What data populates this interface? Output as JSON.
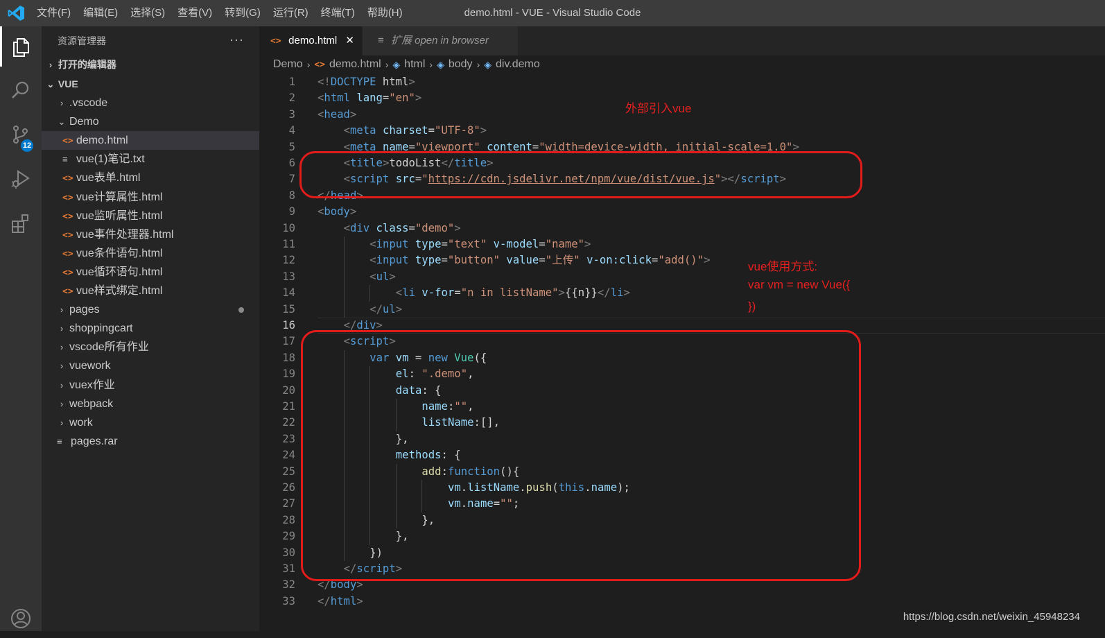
{
  "window": {
    "title": "demo.html - VUE - Visual Studio Code",
    "menu": [
      "文件(F)",
      "编辑(E)",
      "选择(S)",
      "查看(V)",
      "转到(G)",
      "运行(R)",
      "终端(T)",
      "帮助(H)"
    ]
  },
  "activity_bar": {
    "icons": [
      "explorer-icon",
      "search-icon",
      "source-control-icon",
      "run-debug-icon",
      "extensions-icon",
      "account-icon"
    ],
    "scm_badge": "12"
  },
  "sidebar": {
    "title": "资源管理器",
    "more_label": "···",
    "open_editors_label": "打开的编辑器",
    "workspace_label": "VUE",
    "tree": [
      {
        "label": ".vscode",
        "kind": "folder",
        "expanded": false,
        "depth": 1
      },
      {
        "label": "Demo",
        "kind": "folder",
        "expanded": true,
        "depth": 1
      },
      {
        "label": "demo.html",
        "kind": "html",
        "depth": 2,
        "selected": true
      },
      {
        "label": "vue(1)笔记.txt",
        "kind": "txt",
        "depth": 2
      },
      {
        "label": "vue表单.html",
        "kind": "html",
        "depth": 2
      },
      {
        "label": "vue计算属性.html",
        "kind": "html",
        "depth": 2
      },
      {
        "label": "vue监听属性.html",
        "kind": "html",
        "depth": 2
      },
      {
        "label": "vue事件处理器.html",
        "kind": "html",
        "depth": 2
      },
      {
        "label": "vue条件语句.html",
        "kind": "html",
        "depth": 2
      },
      {
        "label": "vue循环语句.html",
        "kind": "html",
        "depth": 2
      },
      {
        "label": "vue样式绑定.html",
        "kind": "html",
        "depth": 2
      },
      {
        "label": "pages",
        "kind": "folder",
        "expanded": false,
        "depth": 1,
        "modified": true
      },
      {
        "label": "shoppingcart",
        "kind": "folder",
        "expanded": false,
        "depth": 1
      },
      {
        "label": "vscode所有作业",
        "kind": "folder",
        "expanded": false,
        "depth": 1
      },
      {
        "label": "vuework",
        "kind": "folder",
        "expanded": false,
        "depth": 1
      },
      {
        "label": "vuex作业",
        "kind": "folder",
        "expanded": false,
        "depth": 1
      },
      {
        "label": "webpack",
        "kind": "folder",
        "expanded": false,
        "depth": 1
      },
      {
        "label": "work",
        "kind": "folder",
        "expanded": false,
        "depth": 1
      },
      {
        "label": "pages.rar",
        "kind": "txt",
        "depth": 1
      }
    ]
  },
  "tabs": [
    {
      "label": "demo.html",
      "active": true,
      "close": "✕"
    },
    {
      "label": "扩展 open in browser",
      "active": false
    }
  ],
  "breadcrumb": [
    "Demo",
    "demo.html",
    "html",
    "body",
    "div.demo"
  ],
  "editor": {
    "current_line": 16,
    "lines": [
      {
        "n": 1,
        "indent": 0,
        "tokens": [
          [
            "punc",
            "<!"
          ],
          [
            "tag",
            "DOCTYPE "
          ],
          [
            "txt",
            "html"
          ],
          [
            "punc",
            ">"
          ]
        ]
      },
      {
        "n": 2,
        "indent": 0,
        "tokens": [
          [
            "punc",
            "<"
          ],
          [
            "tag",
            "html "
          ],
          [
            "attr",
            "lang"
          ],
          [
            "txt",
            "="
          ],
          [
            "str",
            "\"en\""
          ],
          [
            "punc",
            ">"
          ]
        ]
      },
      {
        "n": 3,
        "indent": 0,
        "tokens": [
          [
            "punc",
            "<"
          ],
          [
            "tag",
            "head"
          ],
          [
            "punc",
            ">"
          ]
        ]
      },
      {
        "n": 4,
        "indent": 1,
        "tokens": [
          [
            "punc",
            "<"
          ],
          [
            "tag",
            "meta "
          ],
          [
            "attr",
            "charset"
          ],
          [
            "txt",
            "="
          ],
          [
            "str",
            "\"UTF-8\""
          ],
          [
            "punc",
            ">"
          ]
        ]
      },
      {
        "n": 5,
        "indent": 1,
        "tokens": [
          [
            "punc",
            "<"
          ],
          [
            "tag",
            "meta "
          ],
          [
            "attr",
            "name"
          ],
          [
            "txt",
            "="
          ],
          [
            "str",
            "\"viewport\" "
          ],
          [
            "attr",
            "content"
          ],
          [
            "txt",
            "="
          ],
          [
            "str",
            "\"width=device-width, initial-scale=1.0\""
          ],
          [
            "punc",
            ">"
          ]
        ]
      },
      {
        "n": 6,
        "indent": 1,
        "tokens": [
          [
            "punc",
            "<"
          ],
          [
            "tag",
            "title"
          ],
          [
            "punc",
            ">"
          ],
          [
            "txt",
            "todoList"
          ],
          [
            "punc",
            "</"
          ],
          [
            "tag",
            "title"
          ],
          [
            "punc",
            ">"
          ]
        ]
      },
      {
        "n": 7,
        "indent": 1,
        "tokens": [
          [
            "punc",
            "<"
          ],
          [
            "tag",
            "script "
          ],
          [
            "attr",
            "src"
          ],
          [
            "txt",
            "="
          ],
          [
            "str",
            "\""
          ],
          [
            "link",
            "https://cdn.jsdelivr.net/npm/vue/dist/vue.js"
          ],
          [
            "str",
            "\""
          ],
          [
            "punc",
            "></"
          ],
          [
            "tag",
            "script"
          ],
          [
            "punc",
            ">"
          ]
        ]
      },
      {
        "n": 8,
        "indent": 0,
        "tokens": [
          [
            "punc",
            "</"
          ],
          [
            "tag",
            "head"
          ],
          [
            "punc",
            ">"
          ]
        ]
      },
      {
        "n": 9,
        "indent": 0,
        "tokens": [
          [
            "punc",
            "<"
          ],
          [
            "tag",
            "body"
          ],
          [
            "punc",
            ">"
          ]
        ]
      },
      {
        "n": 10,
        "indent": 1,
        "tokens": [
          [
            "punc",
            "<"
          ],
          [
            "tag",
            "div "
          ],
          [
            "attr",
            "class"
          ],
          [
            "txt",
            "="
          ],
          [
            "str",
            "\"demo\""
          ],
          [
            "punc",
            ">"
          ]
        ]
      },
      {
        "n": 11,
        "indent": 2,
        "tokens": [
          [
            "punc",
            "<"
          ],
          [
            "tag",
            "input "
          ],
          [
            "attr",
            "type"
          ],
          [
            "txt",
            "="
          ],
          [
            "str",
            "\"text\" "
          ],
          [
            "attr",
            "v-model"
          ],
          [
            "txt",
            "="
          ],
          [
            "str",
            "\"name\""
          ],
          [
            "punc",
            ">"
          ]
        ]
      },
      {
        "n": 12,
        "indent": 2,
        "tokens": [
          [
            "punc",
            "<"
          ],
          [
            "tag",
            "input "
          ],
          [
            "attr",
            "type"
          ],
          [
            "txt",
            "="
          ],
          [
            "str",
            "\"button\" "
          ],
          [
            "attr",
            "value"
          ],
          [
            "txt",
            "="
          ],
          [
            "str",
            "\"上传\" "
          ],
          [
            "attr",
            "v-on:click"
          ],
          [
            "txt",
            "="
          ],
          [
            "str",
            "\"add()\""
          ],
          [
            "punc",
            ">"
          ]
        ]
      },
      {
        "n": 13,
        "indent": 2,
        "tokens": [
          [
            "punc",
            "<"
          ],
          [
            "tag",
            "ul"
          ],
          [
            "punc",
            ">"
          ]
        ]
      },
      {
        "n": 14,
        "indent": 3,
        "tokens": [
          [
            "punc",
            "<"
          ],
          [
            "tag",
            "li "
          ],
          [
            "attr",
            "v-for"
          ],
          [
            "txt",
            "="
          ],
          [
            "str",
            "\"n in listName\""
          ],
          [
            "punc",
            ">"
          ],
          [
            "txt",
            "{{n}}"
          ],
          [
            "punc",
            "</"
          ],
          [
            "tag",
            "li"
          ],
          [
            "punc",
            ">"
          ]
        ]
      },
      {
        "n": 15,
        "indent": 2,
        "tokens": [
          [
            "punc",
            "</"
          ],
          [
            "tag",
            "ul"
          ],
          [
            "punc",
            ">"
          ]
        ]
      },
      {
        "n": 16,
        "indent": 1,
        "tokens": [
          [
            "punc",
            "</"
          ],
          [
            "tag",
            "div"
          ],
          [
            "punc",
            ">"
          ]
        ]
      },
      {
        "n": 17,
        "indent": 1,
        "tokens": [
          [
            "punc",
            "<"
          ],
          [
            "tag",
            "script"
          ],
          [
            "punc",
            ">"
          ]
        ]
      },
      {
        "n": 18,
        "indent": 2,
        "tokens": [
          [
            "kw",
            "var "
          ],
          [
            "var",
            "vm "
          ],
          [
            "txt",
            "= "
          ],
          [
            "kw",
            "new "
          ],
          [
            "cls",
            "Vue"
          ],
          [
            "txt",
            "({"
          ]
        ]
      },
      {
        "n": 19,
        "indent": 3,
        "tokens": [
          [
            "var",
            "el"
          ],
          [
            "txt",
            ": "
          ],
          [
            "str",
            "\".demo\""
          ],
          [
            "txt",
            ","
          ]
        ]
      },
      {
        "n": 20,
        "indent": 3,
        "tokens": [
          [
            "var",
            "data"
          ],
          [
            "txt",
            ": {"
          ]
        ]
      },
      {
        "n": 21,
        "indent": 4,
        "tokens": [
          [
            "var",
            "name"
          ],
          [
            "txt",
            ":"
          ],
          [
            "str",
            "\"\""
          ],
          [
            "txt",
            ","
          ]
        ]
      },
      {
        "n": 22,
        "indent": 4,
        "tokens": [
          [
            "var",
            "listName"
          ],
          [
            "txt",
            ":[],"
          ]
        ]
      },
      {
        "n": 23,
        "indent": 3,
        "tokens": [
          [
            "txt",
            "},"
          ]
        ]
      },
      {
        "n": 24,
        "indent": 3,
        "tokens": [
          [
            "var",
            "methods"
          ],
          [
            "txt",
            ": {"
          ]
        ]
      },
      {
        "n": 25,
        "indent": 4,
        "tokens": [
          [
            "fn",
            "add"
          ],
          [
            "txt",
            ":"
          ],
          [
            "kw",
            "function"
          ],
          [
            "txt",
            "(){"
          ]
        ]
      },
      {
        "n": 26,
        "indent": 5,
        "tokens": [
          [
            "var",
            "vm"
          ],
          [
            "txt",
            "."
          ],
          [
            "var",
            "listName"
          ],
          [
            "txt",
            "."
          ],
          [
            "fn",
            "push"
          ],
          [
            "txt",
            "("
          ],
          [
            "kw",
            "this"
          ],
          [
            "txt",
            "."
          ],
          [
            "var",
            "name"
          ],
          [
            "txt",
            ");"
          ]
        ]
      },
      {
        "n": 27,
        "indent": 5,
        "tokens": [
          [
            "var",
            "vm"
          ],
          [
            "txt",
            "."
          ],
          [
            "var",
            "name"
          ],
          [
            "txt",
            "="
          ],
          [
            "str",
            "\"\""
          ],
          [
            "txt",
            ";"
          ]
        ]
      },
      {
        "n": 28,
        "indent": 4,
        "tokens": [
          [
            "txt",
            "},"
          ]
        ]
      },
      {
        "n": 29,
        "indent": 3,
        "tokens": [
          [
            "txt",
            "},"
          ]
        ]
      },
      {
        "n": 30,
        "indent": 2,
        "tokens": [
          [
            "txt",
            "})"
          ]
        ]
      },
      {
        "n": 31,
        "indent": 1,
        "tokens": [
          [
            "punc",
            "</"
          ],
          [
            "tag",
            "script"
          ],
          [
            "punc",
            ">"
          ]
        ]
      },
      {
        "n": 32,
        "indent": 0,
        "tokens": [
          [
            "punc",
            "</"
          ],
          [
            "tag",
            "body"
          ],
          [
            "punc",
            ">"
          ]
        ]
      },
      {
        "n": 33,
        "indent": 0,
        "tokens": [
          [
            "punc",
            "</"
          ],
          [
            "tag",
            "html"
          ],
          [
            "punc",
            ">"
          ]
        ]
      }
    ]
  },
  "annotations": {
    "note1": "外部引入vue",
    "note2_lines": [
      "vue使用方式:",
      "var vm = new Vue({",
      "})"
    ],
    "color": "#e21b1b"
  },
  "watermark": "https://blog.csdn.net/weixin_45948234"
}
